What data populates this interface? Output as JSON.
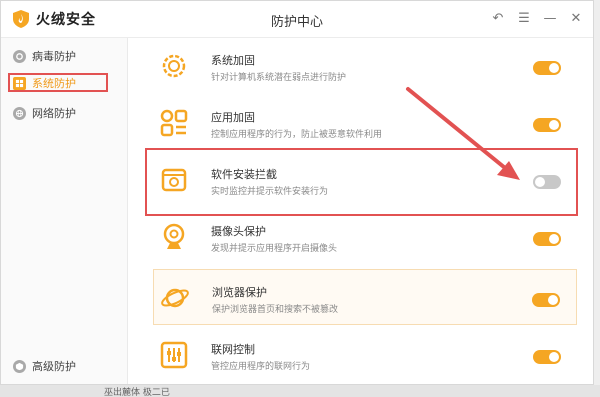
{
  "app": {
    "brand": "火绒安全",
    "window_title": "防护中心"
  },
  "colors": {
    "accent": "#f5a623",
    "highlight": "#e25252",
    "toggle_off": "#c8c8c8"
  },
  "window_controls": [
    {
      "icon": "back-arrow-icon",
      "glyph": "↶"
    },
    {
      "icon": "menu-icon",
      "glyph": "☰"
    },
    {
      "icon": "minimize-icon",
      "glyph": "—"
    },
    {
      "icon": "close-icon",
      "glyph": "✕"
    }
  ],
  "sidebar": {
    "items": [
      {
        "label": "病毒防护",
        "icon": "shield-virus-icon",
        "active": false
      },
      {
        "label": "系统防护",
        "icon": "system-protect-icon",
        "active": true
      },
      {
        "label": "网络防护",
        "icon": "globe-icon",
        "active": false
      }
    ],
    "footer_item": {
      "label": "高级防护",
      "icon": "advanced-protect-icon"
    }
  },
  "features": [
    {
      "title": "系统加固",
      "desc": "针对计算机系统潜在弱点进行防护",
      "icon": "gear-shield-icon",
      "enabled": true
    },
    {
      "title": "应用加固",
      "desc": "控制应用程序的行为，防止被恶意软件利用",
      "icon": "app-grid-icon",
      "enabled": true
    },
    {
      "title": "软件安装拦截",
      "desc": "实时监控并提示软件安装行为",
      "icon": "install-block-icon",
      "enabled": false
    },
    {
      "title": "摄像头保护",
      "desc": "发现并提示应用程序开启摄像头",
      "icon": "webcam-icon",
      "enabled": true
    },
    {
      "title": "浏览器保护",
      "desc": "保护浏览器首页和搜索不被篡改",
      "icon": "planet-icon",
      "enabled": true
    },
    {
      "title": "联网控制",
      "desc": "管控应用程序的联网行为",
      "icon": "sliders-icon",
      "enabled": true
    }
  ],
  "taskbar": {
    "text": "巫出麓体 极二已"
  }
}
